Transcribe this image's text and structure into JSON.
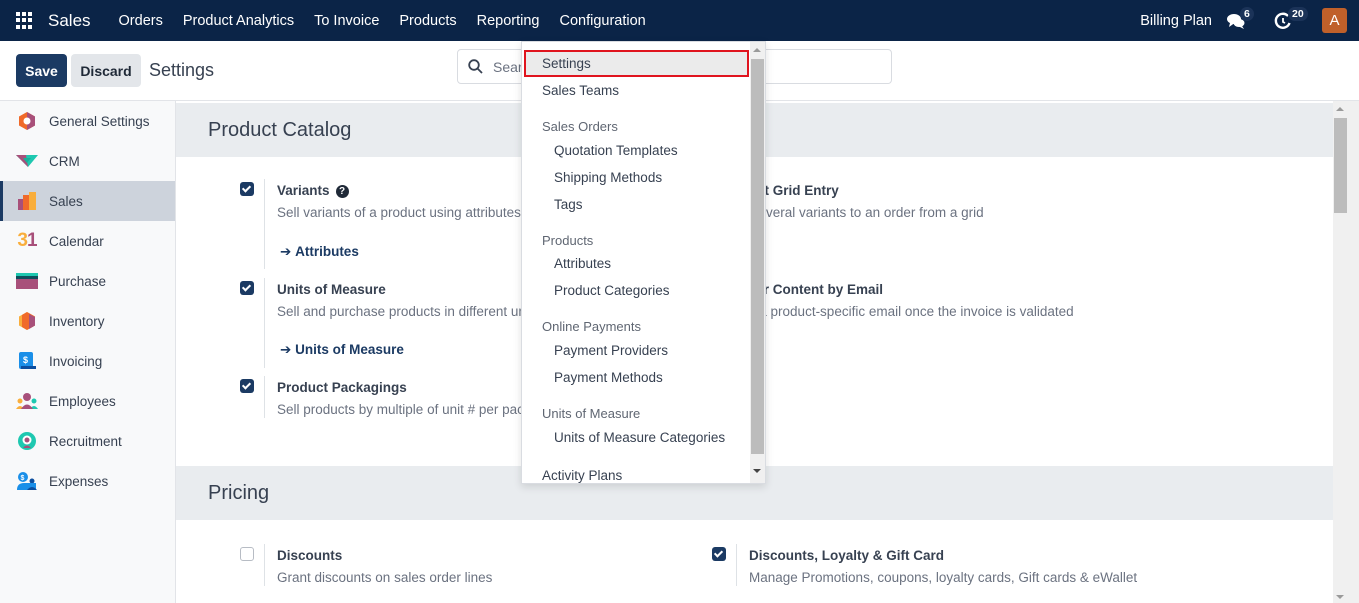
{
  "navbar": {
    "app_name": "Sales",
    "menu": [
      "Orders",
      "Product Analytics",
      "To Invoice",
      "Products",
      "Reporting",
      "Configuration"
    ],
    "billing_plan": "Billing Plan",
    "messages_count": "6",
    "activities_count": "20",
    "avatar_initial": "A",
    "avatar_color": "#c0602a",
    "bg_color": "#0b2447"
  },
  "control": {
    "save_label": "Save",
    "discard_label": "Discard",
    "title": "Settings",
    "search_placeholder": "Search..."
  },
  "sidebar": {
    "items": [
      {
        "label": "General Settings",
        "icon": "general-settings-icon"
      },
      {
        "label": "CRM",
        "icon": "crm-icon"
      },
      {
        "label": "Sales",
        "icon": "sales-icon",
        "active": true
      },
      {
        "label": "Calendar",
        "icon": "calendar-icon"
      },
      {
        "label": "Purchase",
        "icon": "purchase-icon"
      },
      {
        "label": "Inventory",
        "icon": "inventory-icon"
      },
      {
        "label": "Invoicing",
        "icon": "invoicing-icon"
      },
      {
        "label": "Employees",
        "icon": "employees-icon"
      },
      {
        "label": "Recruitment",
        "icon": "recruitment-icon"
      },
      {
        "label": "Expenses",
        "icon": "expenses-icon"
      }
    ],
    "calendar_glyph": "31"
  },
  "sections": {
    "product_catalog": {
      "title": "Product Catalog",
      "settings": {
        "variants": {
          "title": "Variants",
          "desc": "Sell variants of a product using attributes (size, color, etc.)",
          "link": "Attributes",
          "checked": true
        },
        "variant_grid": {
          "title": "Variant Grid Entry",
          "desc": "Add several variants to an order from a grid"
        },
        "uom": {
          "title": "Units of Measure",
          "desc": "Sell and purchase products in different units of measure",
          "link": "Units of Measure",
          "checked": true
        },
        "deliver_email": {
          "title": "Deliver Content by Email",
          "desc": "Send a product-specific email once the invoice is validated"
        },
        "packagings": {
          "title": "Product Packagings",
          "desc": "Sell products by multiple of unit # per package",
          "checked": true
        }
      }
    },
    "pricing": {
      "title": "Pricing",
      "settings": {
        "discounts": {
          "title": "Discounts",
          "desc": "Grant discounts on sales order lines",
          "checked": false
        },
        "loyalty": {
          "title": "Discounts, Loyalty & Gift Card",
          "desc": "Manage Promotions, coupons, loyalty cards, Gift cards & eWallet",
          "checked": true
        }
      }
    }
  },
  "dropdown": {
    "settings": "Settings",
    "sales_teams": "Sales Teams",
    "sales_orders_header": "Sales Orders",
    "quotation_templates": "Quotation Templates",
    "shipping_methods": "Shipping Methods",
    "tags": "Tags",
    "products_header": "Products",
    "attributes": "Attributes",
    "product_categories": "Product Categories",
    "online_payments_header": "Online Payments",
    "payment_providers": "Payment Providers",
    "payment_methods": "Payment Methods",
    "uom_header": "Units of Measure",
    "uom_categories": "Units of Measure Categories",
    "activity_plans": "Activity Plans",
    "highlight_color": "#e0141e"
  },
  "arrow_glyph": "➔",
  "help_glyph": "?"
}
